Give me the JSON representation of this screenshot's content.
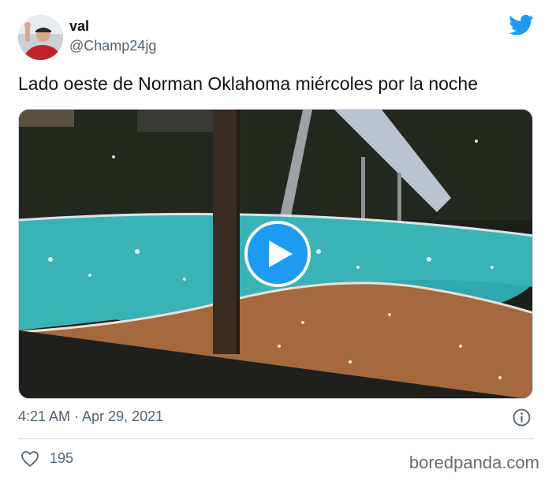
{
  "tweet": {
    "user": {
      "name": "val",
      "handle": "@Champ24jg",
      "avatar_icon": "avatar-photo"
    },
    "text": "Lado oeste de Norman Oklahoma miércoles por la noche",
    "timestamp": "4:21 AM · Apr 29, 2021",
    "likes": "195",
    "media": {
      "type": "video",
      "play_icon": "play-icon"
    }
  },
  "brand": {
    "twitter_icon": "twitter-bird-icon",
    "twitter_color": "#1d9bf0",
    "watermark": "boredpanda.com"
  },
  "icons": {
    "info": "info-icon",
    "like": "heart-icon"
  }
}
